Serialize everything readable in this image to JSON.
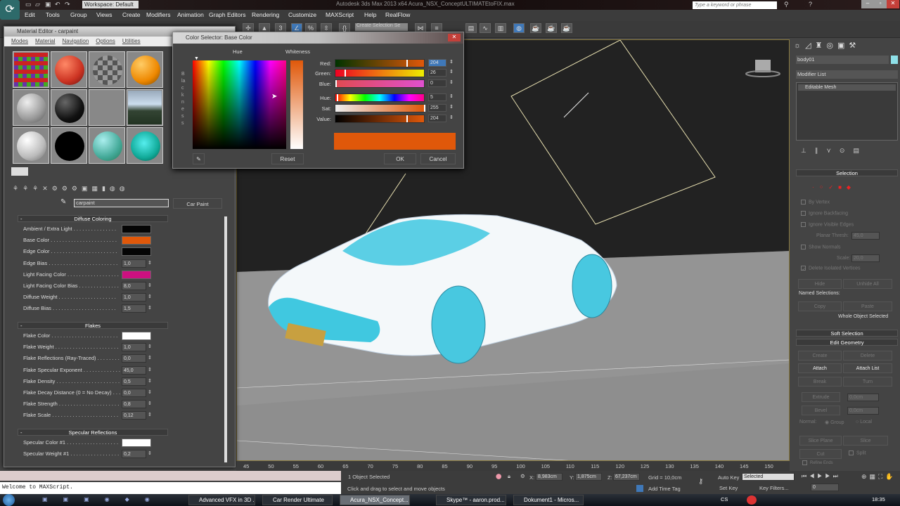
{
  "app": {
    "title": "Autodesk 3ds Max 2013 x64    Acura_NSX_ConceptULTIMATEtoFIX.max",
    "workspace": "Workspace: Default",
    "search_placeholder": "Type a keyword or phrase"
  },
  "menu": [
    "Edit",
    "Tools",
    "Group",
    "Views",
    "Create",
    "Modifiers",
    "Animation",
    "Graph Editors",
    "Rendering",
    "Customize",
    "MAXScript",
    "Help",
    "RealFlow"
  ],
  "toolbar": {
    "selection_set": "Create Selection Se",
    "snap_label": "3"
  },
  "material_editor": {
    "title": "Material Editor - carpaint",
    "menu": [
      "Modes",
      "Material",
      "Navigation",
      "Options",
      "Utilities"
    ],
    "material_name": "carpaint",
    "material_type": "Car Paint",
    "sections": [
      {
        "title": "Diffuse Coloring",
        "params": [
          {
            "label": "Ambient / Extra Light . . . . . . . . . . . . . . .",
            "color": "#050505"
          },
          {
            "label": "Base Color . . . . . . . . . . . . . . . . . . . . . . .",
            "color": "#e0580a"
          },
          {
            "label": "Edge Color . . . . . . . . . . . . . . . . . . . . . . .",
            "color": "#050505"
          },
          {
            "label": "Edge Bias . . . . . . . . . . . . . . . . . . . . . . . .",
            "value": "1,0"
          },
          {
            "label": "Light Facing Color . . . . . . . . . . . . . . . . . .",
            "color": "#cc1080"
          },
          {
            "label": "Light Facing Color Bias . . . . . . . . . . . . . .",
            "value": "8,0"
          },
          {
            "label": "Diffuse Weight . . . . . . . . . . . . . . . . . . . .",
            "value": "1,0"
          },
          {
            "label": "Diffuse Bias . . . . . . . . . . . . . . . . . . . . . .",
            "value": "1,5"
          }
        ]
      },
      {
        "title": "Flakes",
        "params": [
          {
            "label": "Flake Color . . . . . . . . . . . . . . . . . . . . . . .",
            "color": "#ffffff"
          },
          {
            "label": "Flake Weight . . . . . . . . . . . . . . . . . . . . . .",
            "value": "1,0"
          },
          {
            "label": "Flake Reflections (Ray-Traced) . . . . . . . .",
            "value": "0,0"
          },
          {
            "label": "Flake Specular Exponent . . . . . . . . . . . . .",
            "value": "45,0"
          },
          {
            "label": "Flake Density . . . . . . . . . . . . . . . . . . . . . .",
            "value": "0,5"
          },
          {
            "label": "Flake Decay Distance (0 = No Decay) . . . .",
            "value": "0,0"
          },
          {
            "label": "Flake Strength . . . . . . . . . . . . . . . . . . . . .",
            "value": "0,8"
          },
          {
            "label": "Flake Scale . . . . . . . . . . . . . . . . . . . . . . .",
            "value": "0,12"
          }
        ]
      },
      {
        "title": "Specular Reflections",
        "params": [
          {
            "label": "Specular Color #1 . . . . . . . . . . . . . . . . . .",
            "color": "#ffffff"
          },
          {
            "label": "Specular Weight #1 . . . . . . . . . . . . . . . . .",
            "value": "0,2"
          }
        ]
      }
    ]
  },
  "color_selector": {
    "title": "Color Selector: Base Color",
    "hue_label": "Hue",
    "whiteness_label": "Whiteness",
    "blackness_label": "Blackness",
    "channels": [
      {
        "label": "Red:",
        "value": "204",
        "max": 255
      },
      {
        "label": "Green:",
        "value": "26",
        "max": 255
      },
      {
        "label": "Blue:",
        "value": "0",
        "max": 255
      },
      {
        "label": "Hue:",
        "value": "5",
        "max": 255
      },
      {
        "label": "Sat:",
        "value": "255",
        "max": 255
      },
      {
        "label": "Value:",
        "value": "204",
        "max": 255
      }
    ],
    "preview_color": "#e0580a",
    "reset_label": "Reset",
    "ok_label": "OK",
    "cancel_label": "Cancel"
  },
  "command_panel": {
    "object_name": "body01",
    "modifier_list": "Modifier List",
    "stack_item": "Editable Mesh",
    "selection": {
      "title": "Selection",
      "by_vertex": "By Vertex",
      "ignore_backfacing": "Ignore Backfacing",
      "ignore_visible_edges": "Ignore Visible Edges",
      "planar_thresh_label": "Planar Thresh:",
      "planar_thresh": "45,0",
      "show_normals": "Show Normals",
      "scale_label": "Scale:",
      "scale": "20,0",
      "delete_isolated": "Delete Isolated Vertices",
      "hide": "Hide",
      "unhide_all": "Unhide All",
      "named_selections": "Named Selections:",
      "copy": "Copy",
      "paste": "Paste",
      "status": "Whole Object Selected"
    },
    "soft_selection": "Soft Selection",
    "edit_geometry": {
      "title": "Edit Geometry",
      "create": "Create",
      "delete": "Delete",
      "attach": "Attach",
      "attach_list": "Attach List",
      "break": "Break",
      "turn": "Turn",
      "extrude": "Extrude",
      "extrude_val": "0,0cm",
      "bevel": "Bevel",
      "bevel_val": "0,0cm",
      "normal_label": "Normal:",
      "group": "Group",
      "local": "Local",
      "slice_plane": "Slice Plane",
      "slice": "Slice",
      "cut": "Cut",
      "split": "Split",
      "refine_ends": "Refine Ends"
    }
  },
  "timeline": {
    "ticks": [
      "45",
      "50",
      "55",
      "60",
      "65",
      "70",
      "75",
      "80",
      "85",
      "90",
      "95",
      "100",
      "105",
      "110",
      "115",
      "120",
      "125",
      "130",
      "135",
      "140",
      "145",
      "150"
    ]
  },
  "status": {
    "maxscript": "Welcome to MAXScript.",
    "selected": "1 Object Selected",
    "prompt": "Click and drag to select and move objects",
    "x_label": "X:",
    "x": "8,983cm",
    "y_label": "Y:",
    "y": "1,875cm",
    "z_label": "Z:",
    "z": "67,237cm",
    "grid": "Grid = 10,0cm",
    "add_time_tag": "Add Time Tag",
    "auto_key": "Auto Key",
    "set_key": "Set Key",
    "key_mode": "Selected",
    "key_filters": "Key Filters...",
    "frame": "0"
  },
  "taskbar": {
    "items": [
      "Advanced VFX in 3D ...",
      "Car Render Ultimate",
      "Acura_NSX_Concept...",
      "Skype™ - aaron.prod...",
      "Dokument1 - Micros..."
    ],
    "lang": "CS",
    "clock": "18:35"
  }
}
